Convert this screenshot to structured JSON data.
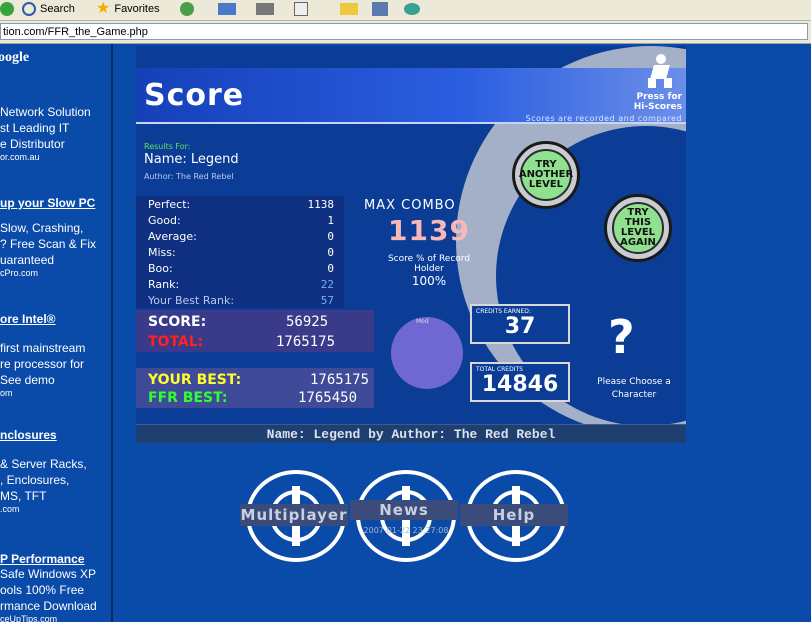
{
  "toolbar": {
    "search_label": "Search",
    "favorites_label": "Favorites"
  },
  "address": {
    "url": "tion.com/FFR_the_Game.php"
  },
  "sidebar": {
    "logo": "oogle",
    "ads": [
      {
        "title": "",
        "lines": [
          "Network Solution",
          "st Leading IT",
          "e Distributor"
        ],
        "url": "or.com.au"
      },
      {
        "title": "up your Slow PC",
        "lines": [
          "Slow, Crashing,",
          "? Free Scan & Fix",
          "uaranteed"
        ],
        "url": "cPro.com"
      },
      {
        "title": "ore Intel®",
        "lines": [
          "first mainstream",
          "re processor for",
          "See demo"
        ],
        "url": "om"
      },
      {
        "title": "nclosures",
        "lines": [
          "& Server Racks,",
          ", Enclosures,",
          "MS, TFT"
        ],
        "url": ".com"
      },
      {
        "title": "P Performance",
        "lines": [
          "Safe Windows XP",
          "ools 100% Free",
          "rmance Download"
        ],
        "url": "ceUpTips.com"
      }
    ]
  },
  "game": {
    "title": "Score",
    "press_for": "Press for",
    "hi_scores": "Hi-Scores",
    "scores_recorded": "Scores are recorded and compared",
    "try_another": "TRY ANOTHER LEVEL",
    "try_again": "TRY THIS LEVEL AGAIN",
    "results_for": "Results For:",
    "name": "Name: Legend",
    "author": "Author: The Red Rebel",
    "stats": [
      {
        "label": "Perfect:",
        "value": "1138"
      },
      {
        "label": "Good:",
        "value": "1"
      },
      {
        "label": "Average:",
        "value": "0"
      },
      {
        "label": "Miss:",
        "value": "0"
      },
      {
        "label": "Boo:",
        "value": "0"
      },
      {
        "label": "Rank:",
        "value": "22"
      },
      {
        "label": "Your Best Rank:",
        "value": "57"
      }
    ],
    "max_combo_label": "MAX COMBO",
    "max_combo": "1139",
    "holder_label": "Score % of Record Holder",
    "holder_pct": "100%",
    "score_label": "SCORE:",
    "score": "56925",
    "total_label": "TOTAL:",
    "total": "1765175",
    "your_best_label": "YOUR BEST:",
    "your_best": "1765175",
    "ffr_best_label": "FFR BEST:",
    "ffr_best": "1765450",
    "mod_label": "Mod",
    "credits_earned_label": "CREDITS EARNED:",
    "credits_earned": "37",
    "total_credits_label": "TOTAL CREDITS",
    "total_credits": "14846",
    "question_mark": "?",
    "choose_char": "Please Choose a Character"
  },
  "song_bar": "Name: Legend by Author: The Red Rebel",
  "nav": {
    "multiplayer": "Multiplayer",
    "news": "News",
    "news_date": "2007-01-22 23:27:08",
    "help": "Help"
  }
}
